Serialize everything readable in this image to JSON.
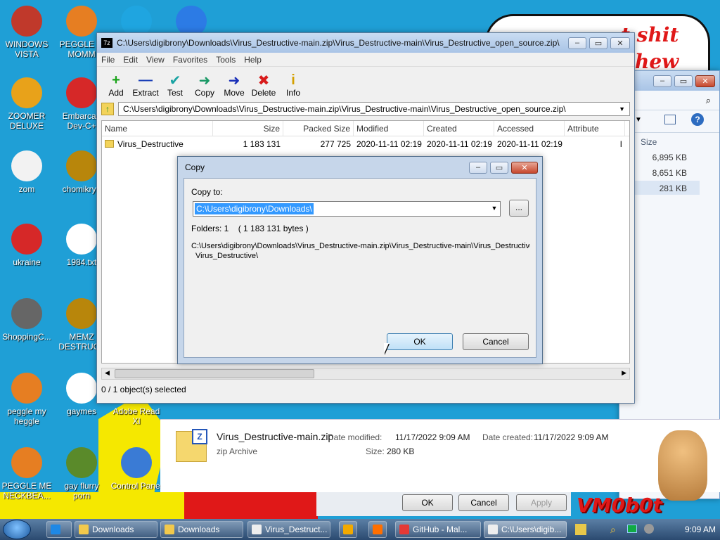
{
  "desktop": {
    "icons": [
      {
        "label": "WINDOWS VISTA",
        "color": "#c0392b"
      },
      {
        "label": "PEGGLE M MOMM",
        "color": "#e67e22"
      },
      {
        "label": "",
        "color": "#1fa5e0"
      },
      {
        "label": "",
        "color": "#2c7be5"
      },
      {
        "label": "ZOOMER DELUXE",
        "color": "#e8a21a"
      },
      {
        "label": "Embarcad Dev-C+",
        "color": "#d62828"
      },
      {
        "label": "zom",
        "color": "#f2f2f2"
      },
      {
        "label": "chomikryp",
        "color": "#b8860b"
      },
      {
        "label": "ukraine",
        "color": "#d62828"
      },
      {
        "label": "1984.txt",
        "color": "#ffffff"
      },
      {
        "label": "ShoppingC...",
        "color": "#666666"
      },
      {
        "label": "MEMZ DESTRUCT",
        "color": "#b8860b"
      },
      {
        "label": "peggle my heggle",
        "color": "#e67e22"
      },
      {
        "label": "gaymes",
        "color": "#ffffff"
      },
      {
        "label": "Adobe Read XI",
        "color": "#d62828"
      },
      {
        "label": "PEGGLE ME NECKBEA...",
        "color": "#e67e22"
      },
      {
        "label": "gay flurry porn",
        "color": "#5a8a2a"
      },
      {
        "label": "Control Panel",
        "color": "#3a7bd5"
      }
    ],
    "speech_text": [
      "t shit",
      "hew"
    ],
    "watermark": "VM0b0t"
  },
  "explorer": {
    "size_header": "Size",
    "sizes": [
      "6,895 KB",
      "8,651 KB",
      "281 KB"
    ],
    "file_name": "Virus_Destructive-main.zip",
    "file_type": "zip Archive",
    "date_modified_label": "Date modified:",
    "date_modified": "11/17/2022 9:09 AM",
    "date_created_label": "Date created:",
    "date_created": "11/17/2022 9:09 AM",
    "size_label": "Size:",
    "size": "280 KB",
    "ok_label": "OK",
    "cancel_label": "Cancel",
    "apply_label": "Apply"
  },
  "sevenzip": {
    "title": "C:\\Users\\digibrony\\Downloads\\Virus_Destructive-main.zip\\Virus_Destructive-main\\Virus_Destructive_open_source.zip\\",
    "menu": [
      "File",
      "Edit",
      "View",
      "Favorites",
      "Tools",
      "Help"
    ],
    "toolbar": [
      {
        "label": "Add",
        "icon": "+",
        "color": "#19a319"
      },
      {
        "label": "Extract",
        "icon": "—",
        "color": "#1a3fb8"
      },
      {
        "label": "Test",
        "icon": "✔",
        "color": "#1aa3a3"
      },
      {
        "label": "Copy",
        "icon": "➜",
        "color": "#1a9966"
      },
      {
        "label": "Move",
        "icon": "➜",
        "color": "#1a2fb8"
      },
      {
        "label": "Delete",
        "icon": "✖",
        "color": "#d81b1b"
      },
      {
        "label": "Info",
        "icon": "i",
        "color": "#d4a000"
      }
    ],
    "address": "C:\\Users\\digibrony\\Downloads\\Virus_Destructive-main.zip\\Virus_Destructive-main\\Virus_Destructive_open_source.zip\\",
    "columns": [
      "Name",
      "Size",
      "Packed Size",
      "Modified",
      "Created",
      "Accessed",
      "Attribute"
    ],
    "rows": [
      {
        "name": "Virus_Destructive",
        "size": "1 183 131",
        "packed": "277 725",
        "modified": "2020-11-11 02:19",
        "created": "2020-11-11 02:19",
        "accessed": "2020-11-11 02:19",
        "attr": "I"
      }
    ],
    "status": "0 / 1 object(s) selected"
  },
  "copy_dialog": {
    "title": "Copy",
    "copy_to_label": "Copy to:",
    "copy_to_value": "C:\\Users\\digibrony\\Downloads\\",
    "browse_label": "...",
    "folders_info": "Folders: 1    ( 1 183 131 bytes )",
    "path_line1": "C:\\Users\\digibrony\\Downloads\\Virus_Destructive-main.zip\\Virus_Destructive-main\\Virus_Destructive_",
    "path_line2": "Virus_Destructive\\",
    "ok_label": "OK",
    "cancel_label": "Cancel"
  },
  "taskbar": {
    "items": [
      {
        "label": "",
        "color": "#1e88e5"
      },
      {
        "label": "Downloads",
        "color": "#f2c94c"
      },
      {
        "label": "Downloads",
        "color": "#f2c94c"
      },
      {
        "label": "Virus_Destruct...",
        "color": "#eeeeee"
      },
      {
        "label": "",
        "color": "#f2a900"
      },
      {
        "label": "",
        "color": "#ff6f00"
      },
      {
        "label": "GitHub - Mal...",
        "color": "#e53935"
      },
      {
        "label": "C:\\Users\\digib...",
        "color": "#eeeeee"
      }
    ],
    "clock": "9:09 AM"
  }
}
